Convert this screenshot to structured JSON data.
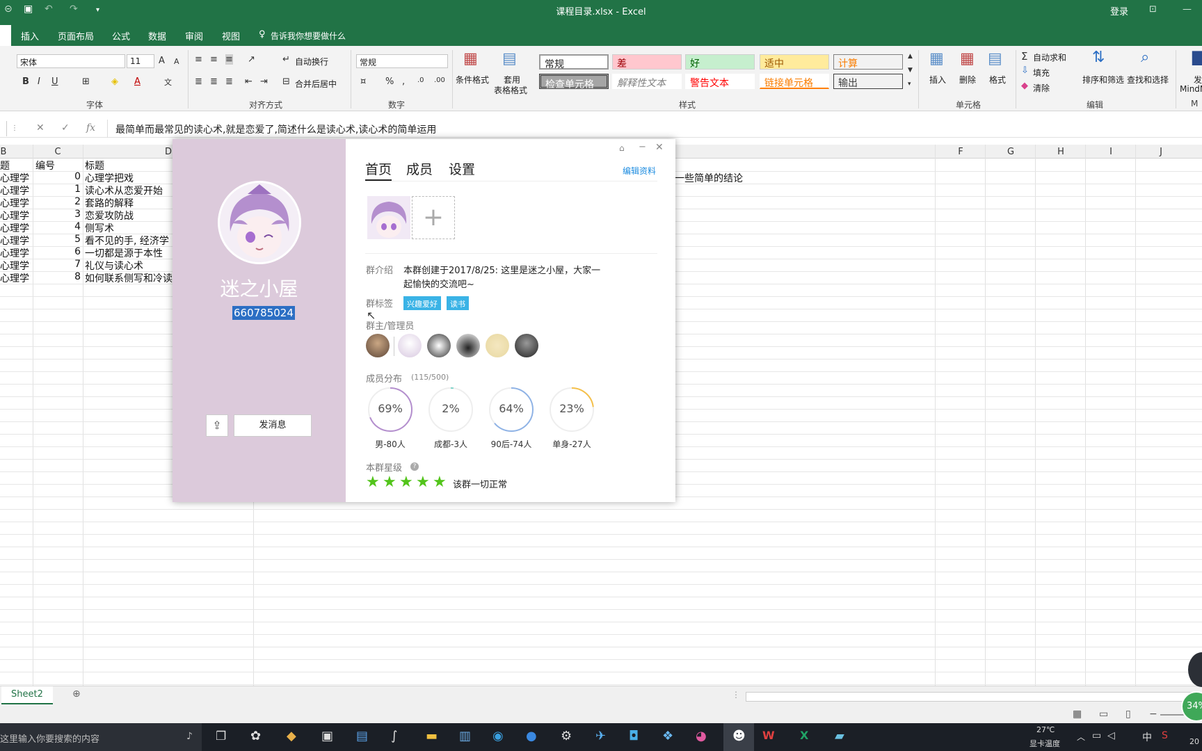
{
  "window": {
    "title": "课程目录.xlsx  -  Excel",
    "login": "登录"
  },
  "ribbon_tabs": [
    "插入",
    "页面布局",
    "公式",
    "数据",
    "审阅",
    "视图"
  ],
  "tell_me": "告诉我你想要做什么",
  "ribbon": {
    "font_name": "宋体",
    "font_size": "11",
    "wrap_text": "自动换行",
    "merge_center": "合并后居中",
    "number_format": "常规",
    "cond_format": "条件格式",
    "table_format_1": "套用",
    "table_format_2": "表格格式",
    "styles": {
      "normal": "常规",
      "bad": "差",
      "good": "好",
      "neutral": "适中",
      "calc": "计算",
      "check_cell": "检查单元格",
      "explanatory": "解释性文本",
      "warning": "警告文本",
      "linked_cell": "链接单元格",
      "output": "输出"
    },
    "insert": "插入",
    "delete": "删除",
    "format": "格式",
    "autosum": "自动求和",
    "fill": "填充",
    "clear": "清除",
    "sort_filter": "排序和筛选",
    "find_select": "查找和选择",
    "groups": {
      "font": "字体",
      "alignment": "对齐方式",
      "number": "数字",
      "styles": "样式",
      "cells": "单元格",
      "editing": "编辑"
    },
    "mind_1": "发",
    "mind_2": "MindM",
    "mind_3": "M"
  },
  "formula_bar": {
    "content": "最简单而最常见的读心术,就是恋爱了,简述什么是读心术,读心术的简单运用"
  },
  "columns": [
    "B",
    "C",
    "D",
    "F",
    "G",
    "H",
    "I",
    "J"
  ],
  "header_row": {
    "b": "题",
    "c": "编号",
    "d": "标题"
  },
  "rows": [
    {
      "b": "心理学",
      "c": "0",
      "d": "心理学把戏"
    },
    {
      "b": "心理学",
      "c": "1",
      "d": "读心术从恋爱开始"
    },
    {
      "b": "心理学",
      "c": "2",
      "d": "套路的解释"
    },
    {
      "b": "心理学",
      "c": "3",
      "d": "恋爱攻防战"
    },
    {
      "b": "心理学",
      "c": "4",
      "d": "侧写术"
    },
    {
      "b": "心理学",
      "c": "5",
      "d": "看不见的手, 经济学"
    },
    {
      "b": "心理学",
      "c": "6",
      "d": "一切都是源于本性"
    },
    {
      "b": "心理学",
      "c": "7",
      "d": "礼仪与读心术"
    },
    {
      "b": "心理学",
      "c": "8",
      "d": "如何联系侧写和冷读"
    }
  ],
  "overflow_text": "一些简单的结论",
  "sheet_tab": "Sheet2",
  "taskbar": {
    "search_placeholder": "这里输入你要搜索的内容",
    "temp": "27℃",
    "temp_label": "显卡温度",
    "ime": "中",
    "time_partial": "20",
    "cpu_badge": "34%"
  },
  "qq": {
    "group_name": "迷之小屋",
    "group_id": "660785024",
    "tabs": [
      "首页",
      "成员",
      "设置"
    ],
    "edit_profile": "编辑资料",
    "intro_label": "群介绍",
    "intro_line1": "本群创建于2017/8/25:  这里是迷之小屋，大家一",
    "intro_line2": "起愉快的交流吧~",
    "tags_label": "群标签",
    "tags": [
      "兴趣爱好",
      "读书"
    ],
    "admins_label": "群主/管理员",
    "dist_label": "成员分布",
    "dist_count": "(115/500)",
    "dist": [
      {
        "pct": "69%",
        "label": "男-80人",
        "value": 0.69,
        "color": "#b48fce"
      },
      {
        "pct": "2%",
        "label": "成都-3人",
        "value": 0.02,
        "color": "#7ed3c8"
      },
      {
        "pct": "64%",
        "label": "90后-74人",
        "value": 0.64,
        "color": "#8fb3e6"
      },
      {
        "pct": "23%",
        "label": "单身-27人",
        "value": 0.23,
        "color": "#f5c04a"
      }
    ],
    "level_label": "本群星级",
    "stars": 5,
    "level_text": "该群一切正常",
    "send_message": "发消息"
  }
}
